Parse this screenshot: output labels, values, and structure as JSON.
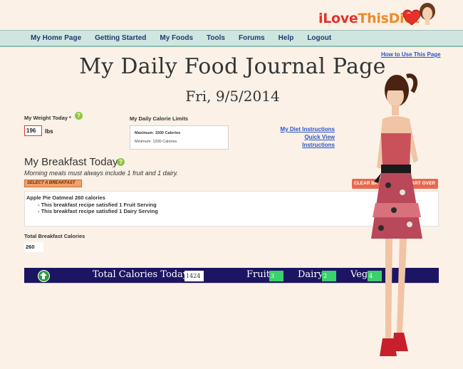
{
  "logo": {
    "i": "i",
    "love": "Love",
    "this": "This",
    "diet": "Diet"
  },
  "nav": [
    {
      "label": "My Home Page"
    },
    {
      "label": "Getting Started"
    },
    {
      "label": "My Foods"
    },
    {
      "label": "Tools"
    },
    {
      "label": "Forums"
    },
    {
      "label": "Help"
    },
    {
      "label": "Logout"
    }
  ],
  "how_to_link": "How to Use This Page",
  "page_title": "My Daily Food Journal Page",
  "date": "Fri, 9/5/2014",
  "weight": {
    "label": "My Weight Today *",
    "value": "196",
    "unit": "lbs",
    "help": "?"
  },
  "calorie_limits": {
    "label": "My Daily Calorie Limits",
    "max": "Maximum: 1500 Calories",
    "min": "Minimum: 1200 Calories"
  },
  "links": {
    "diet_instructions": "My Diet Instructions",
    "quick_view": "Quick View Instructions"
  },
  "breakfast": {
    "title": "My Breakfast Today",
    "help": "?",
    "note": "Morning meals must always include 1 fruit and 1 dairy.",
    "select_button": "SELECT A BREAKFAST",
    "clear_button": "CLEAR BR",
    "start_over_button": "START OVER",
    "recipe_name": "Apple Pie Oatmeal 260 calories",
    "recipe_lines": [
      "- This breakfast recipe satisfied 1 Fruit Serving",
      "- This breakfast recipe satisfied 1 Dairy Serving"
    ],
    "total_label": "Total Breakfast Calories",
    "total_value": "260"
  },
  "totals": {
    "total_label": "Total Calories Today:",
    "total_value": "1424",
    "fruit_label": "Fruit",
    "fruit_value": "3",
    "dairy_label": "Dairy",
    "dairy_value": "2",
    "veg_label": "Veg",
    "veg_value": "4"
  },
  "colors": {
    "accent": "#1c1563",
    "nav_bg": "#cfe6e0",
    "nav_text": "#1f3a73",
    "link": "#2a55c9",
    "serving_green": "#3cd06c"
  }
}
